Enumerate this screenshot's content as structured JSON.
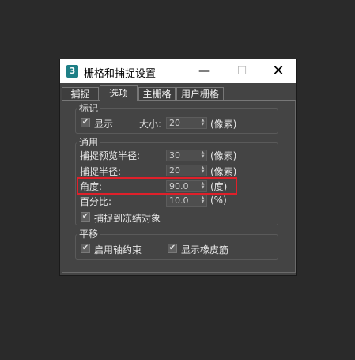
{
  "window": {
    "title": "栅格和捕捉设置",
    "app_icon_text": "3",
    "minimize": "—",
    "maximize": "☐",
    "close": "✕"
  },
  "tabs": [
    {
      "label": "捕捉"
    },
    {
      "label": "选项",
      "active": true
    },
    {
      "label": "主栅格"
    },
    {
      "label": "用户栅格"
    }
  ],
  "marks": {
    "title": "标记",
    "show_label": "显示",
    "show_checked": true,
    "size_label": "大小:",
    "size_value": "20",
    "size_unit": "(像素)"
  },
  "general": {
    "title": "通用",
    "preview_radius_label": "捕捉预览半径:",
    "preview_radius_value": "30",
    "preview_radius_unit": "(像素)",
    "snap_radius_label": "捕捉半径:",
    "snap_radius_value": "20",
    "snap_radius_unit": "(像素)",
    "angle_label": "角度:",
    "angle_value": "90.0",
    "angle_unit": "(度)",
    "percent_label": "百分比:",
    "percent_value": "10.0",
    "percent_unit": "(%)",
    "snap_frozen_label": "捕捉到冻结对象",
    "snap_frozen_checked": true
  },
  "translation": {
    "title": "平移",
    "axis_constraint_label": "启用轴约束",
    "axis_constraint_checked": true,
    "rubber_band_label": "显示橡皮筋",
    "rubber_band_checked": true
  },
  "icons": {
    "check": "✔",
    "spinner": "▲▼"
  },
  "colors": {
    "highlight": "#e0202a",
    "dialog_bg": "#444444",
    "app_icon": "#1e7f86"
  }
}
